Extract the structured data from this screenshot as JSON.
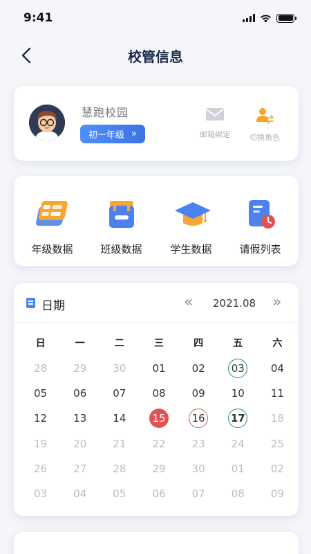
{
  "status": {
    "time": "9:41"
  },
  "nav": {
    "title": "校管信息"
  },
  "profile": {
    "school": "慧跑校园",
    "grade": "初一年级",
    "grade_arrow": "»",
    "actions": [
      {
        "label": "邮箱绑定",
        "icon": "mail-icon"
      },
      {
        "label": "切换角色",
        "icon": "switch-role-icon"
      }
    ]
  },
  "grid": [
    {
      "label": "年级数据",
      "icon": "grade-data-icon"
    },
    {
      "label": "班级数据",
      "icon": "class-data-icon"
    },
    {
      "label": "学生数据",
      "icon": "graduation-cap-icon"
    },
    {
      "label": "请假列表",
      "icon": "leave-list-icon"
    }
  ],
  "calendar": {
    "title": "日期",
    "prev": "«",
    "month": "2021.08",
    "next": "»",
    "weekdays": [
      "日",
      "一",
      "二",
      "三",
      "四",
      "五",
      "六"
    ],
    "weeks": [
      [
        {
          "d": "28",
          "m": true
        },
        {
          "d": "29",
          "m": true
        },
        {
          "d": "30",
          "m": true
        },
        {
          "d": "01"
        },
        {
          "d": "02"
        },
        {
          "d": "03",
          "mark": "ring-teal"
        },
        {
          "d": "04"
        }
      ],
      [
        {
          "d": "05"
        },
        {
          "d": "06"
        },
        {
          "d": "07"
        },
        {
          "d": "08"
        },
        {
          "d": "09"
        },
        {
          "d": "10"
        },
        {
          "d": "11"
        }
      ],
      [
        {
          "d": "12"
        },
        {
          "d": "13"
        },
        {
          "d": "14"
        },
        {
          "d": "15",
          "mark": "today"
        },
        {
          "d": "16",
          "mark": "ring-red"
        },
        {
          "d": "17",
          "mark": "ring-teal bold"
        },
        {
          "d": "18",
          "m": true
        }
      ],
      [
        {
          "d": "19",
          "m": true
        },
        {
          "d": "20",
          "m": true
        },
        {
          "d": "21",
          "m": true
        },
        {
          "d": "22",
          "m": true
        },
        {
          "d": "23",
          "m": true
        },
        {
          "d": "24",
          "m": true
        },
        {
          "d": "25",
          "m": true
        }
      ],
      [
        {
          "d": "26",
          "m": true
        },
        {
          "d": "27",
          "m": true
        },
        {
          "d": "28",
          "m": true
        },
        {
          "d": "29",
          "m": true
        },
        {
          "d": "30",
          "m": true
        },
        {
          "d": "01",
          "m": true
        },
        {
          "d": "02",
          "m": true
        }
      ],
      [
        {
          "d": "03",
          "m": true
        },
        {
          "d": "04",
          "m": true
        },
        {
          "d": "05",
          "m": true
        },
        {
          "d": "06",
          "m": true
        },
        {
          "d": "07",
          "m": true
        },
        {
          "d": "08",
          "m": true
        },
        {
          "d": "09",
          "m": true
        }
      ]
    ]
  },
  "colors": {
    "accent": "#3b74e8",
    "today": "#e25252",
    "ring_teal": "#1e8c7a"
  }
}
